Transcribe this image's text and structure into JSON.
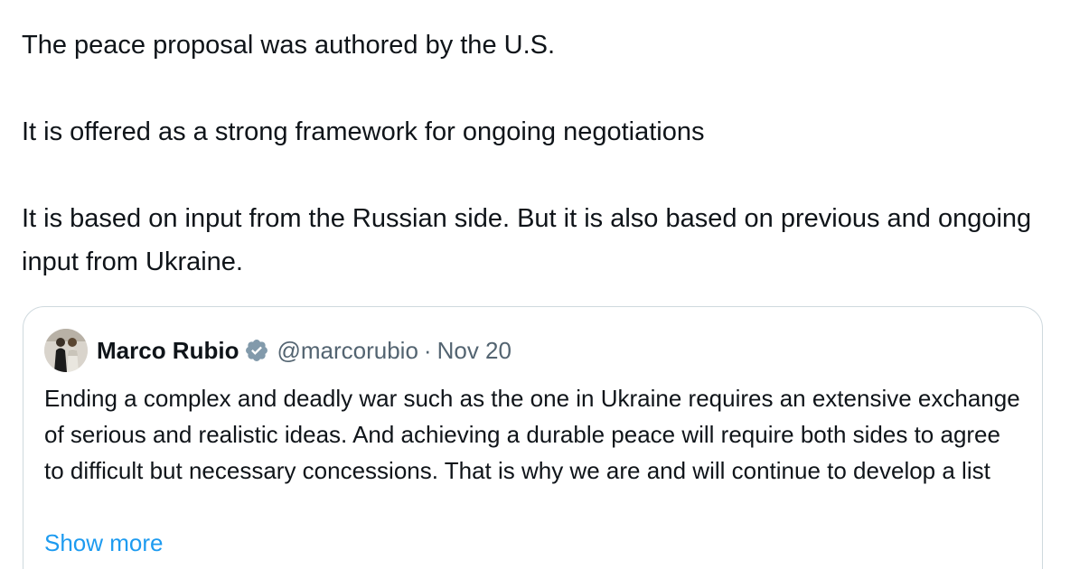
{
  "tweet": {
    "paragraphs": [
      "The peace proposal was authored by the U.S.",
      "It is offered as a strong framework for ongoing negotiations",
      "It is based on input from the Russian side. But it is also based on previous and ongoing input from Ukraine."
    ]
  },
  "quoted": {
    "author_name": "Marco Rubio",
    "handle": "@marcorubio",
    "separator": "·",
    "date": "Nov 20",
    "body": "Ending a complex and deadly war such as the one in Ukraine requires an extensive exchange of serious and realistic ideas. And achieving a durable peace will require both sides to agree to difficult but necessary concessions. That is why we are and will continue to develop a list",
    "show_more": "Show more",
    "verified_badge_color": "#829aab"
  },
  "colors": {
    "text": "#0f1419",
    "secondary": "#536471",
    "link": "#1d9bf0",
    "border": "#cfd9de"
  }
}
